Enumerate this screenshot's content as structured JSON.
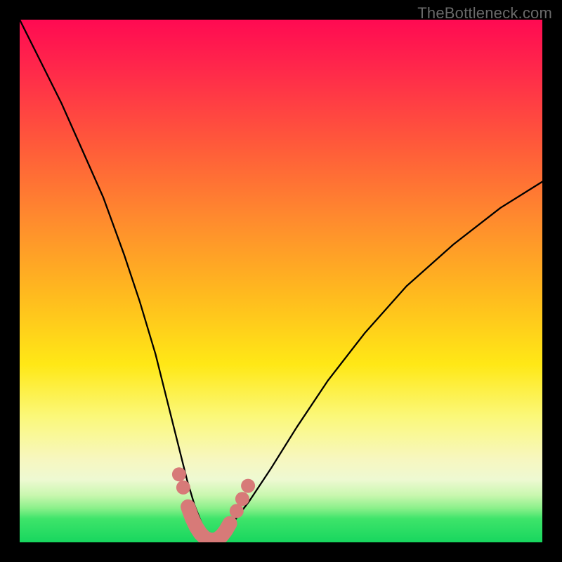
{
  "watermark": "TheBottleneck.com",
  "colors": {
    "frame": "#000000",
    "curve": "#000000",
    "marker_fill": "#d77a78",
    "marker_stroke": "#c96a68",
    "gradient_stops": [
      "#ff0a52",
      "#ff2a4a",
      "#ff5a3a",
      "#ff8a2e",
      "#ffb81f",
      "#ffe816",
      "#fbf87a",
      "#f7f7bf",
      "#eef9d2",
      "#c9f7af",
      "#8af08a",
      "#3ee46a",
      "#17d65e"
    ]
  },
  "chart_data": {
    "type": "line",
    "title": "",
    "xlabel": "",
    "ylabel": "",
    "xlim": [
      0,
      100
    ],
    "ylim": [
      0,
      100
    ],
    "series": [
      {
        "name": "left-curve",
        "x": [
          0,
          4,
          8,
          12,
          16,
          20,
          23,
          26,
          28,
          30,
          32,
          33.5,
          35,
          36,
          37
        ],
        "y": [
          100,
          92,
          84,
          75,
          66,
          55,
          46,
          36,
          28,
          20,
          12,
          7,
          3.2,
          1.4,
          0.3
        ]
      },
      {
        "name": "right-curve",
        "x": [
          37,
          39,
          41,
          44,
          48,
          53,
          59,
          66,
          74,
          83,
          92,
          100
        ],
        "y": [
          0.3,
          1.8,
          4.0,
          8.0,
          14,
          22,
          31,
          40,
          49,
          57,
          64,
          69
        ]
      },
      {
        "name": "valley-markers-discrete",
        "x": [
          30.5,
          31.3,
          41.5,
          42.6,
          43.7
        ],
        "y": [
          13.0,
          10.5,
          6.0,
          8.3,
          10.8
        ]
      },
      {
        "name": "valley-markers-dense",
        "x": [
          32.2,
          33.0,
          33.8,
          34.6,
          35.4,
          36.2,
          37.0,
          37.8,
          38.6,
          39.4,
          40.2
        ],
        "y": [
          6.8,
          4.6,
          2.9,
          1.7,
          0.9,
          0.5,
          0.4,
          0.6,
          1.2,
          2.2,
          3.6
        ]
      }
    ],
    "grid": false,
    "legend": false
  }
}
